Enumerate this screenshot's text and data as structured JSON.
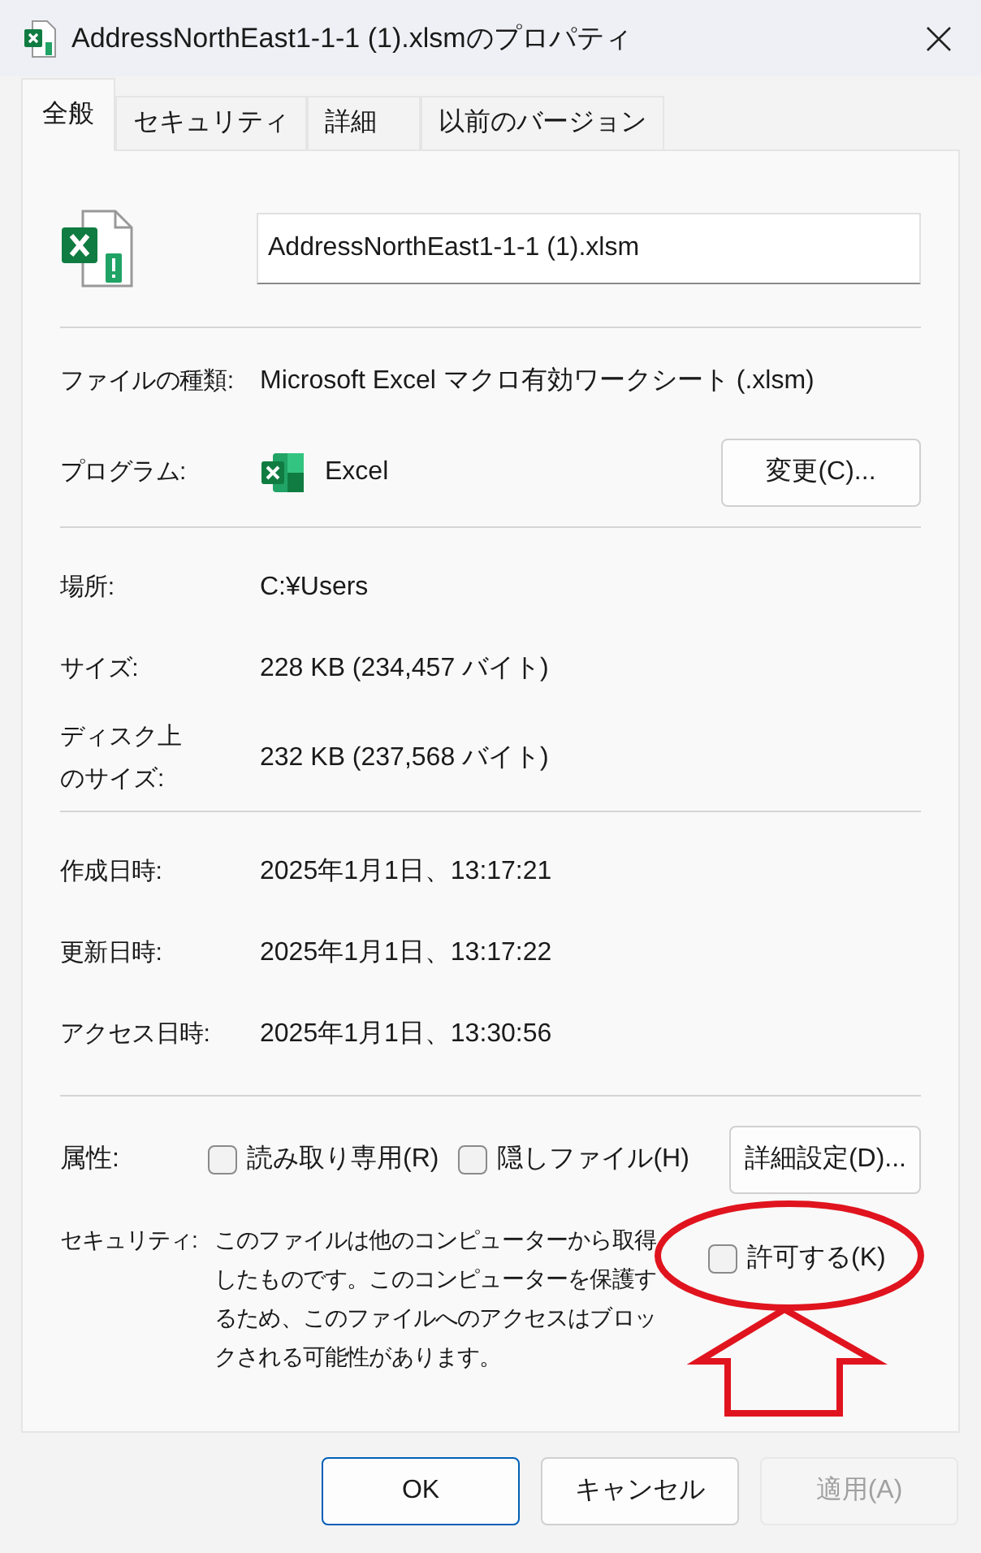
{
  "window": {
    "title": "AddressNorthEast1-1-1 (1).xlsmのプロパティ"
  },
  "tabs": [
    {
      "label": "全般",
      "selected": true
    },
    {
      "label": "セキュリティ",
      "selected": false
    },
    {
      "label": "詳細",
      "selected": false
    },
    {
      "label": "以前のバージョン",
      "selected": false
    }
  ],
  "file_name": {
    "value": "AddressNorthEast1-1-1 (1).xlsm"
  },
  "sections": [
    [
      {
        "kind": "text",
        "label": "ファイルの種類:",
        "value": "Microsoft Excel マクロ有効ワークシート (.xlsm)"
      },
      {
        "kind": "program",
        "label": "プログラム:",
        "value": "Excel",
        "button": "変更(C)..."
      }
    ],
    [
      {
        "kind": "text",
        "label": "場所:",
        "value": "C:¥Users"
      },
      {
        "kind": "text",
        "label": "サイズ:",
        "value": "228 KB (234,457 バイト)"
      },
      {
        "kind": "tall",
        "label": "ディスク上のサイズ:",
        "value": "232 KB (237,568 バイト)"
      }
    ],
    [
      {
        "kind": "text",
        "label": "作成日時:",
        "value": "2025年1月1日、13:17:21"
      },
      {
        "kind": "text",
        "label": "更新日時:",
        "value": "2025年1月1日、13:17:22"
      },
      {
        "kind": "text",
        "label": "アクセス日時:",
        "value": "2025年1月1日、13:30:56"
      }
    ]
  ],
  "attributes": {
    "label": "属性:",
    "options": [
      {
        "label": "読み取り専用(R)",
        "checked": false
      },
      {
        "label": "隠しファイル(H)",
        "checked": false
      }
    ],
    "button": "詳細設定(D)..."
  },
  "security": {
    "label": "セキュリティ:",
    "text": "このファイルは他のコンピューターから取得したものです。このコンピューターを保護するため、このファイルへのアクセスはブロックされる可能性があります。",
    "unblock": {
      "label": "許可する(K)",
      "checked": false
    }
  },
  "buttons": [
    {
      "label": "OK",
      "default": true,
      "disabled": false
    },
    {
      "label": "キャンセル",
      "default": false,
      "disabled": false
    },
    {
      "label": "適用(A)",
      "default": false,
      "disabled": true
    }
  ]
}
